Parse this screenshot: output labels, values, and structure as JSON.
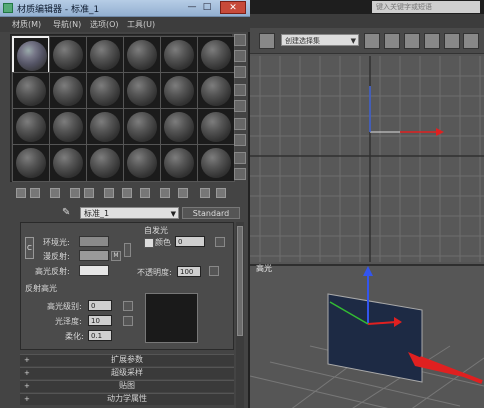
{
  "max_window": {
    "search_placeholder": "键入关键字或短语",
    "selection_set": "创建选择集",
    "viewport_label": "高光",
    "toolbar_icons": [
      "link-icon",
      "unlink-icon",
      "mirror-icon",
      "align-icon",
      "layer-icon",
      "render-setup-icon",
      "render-frame-icon",
      "render-icon"
    ],
    "viewport_bg": "#585858",
    "grid_color": "#6e6e6e",
    "arrow_color": "#e02020"
  },
  "editor": {
    "title": "材质编辑器 - 标准_1",
    "minimize_label": "—",
    "maximize_label": "□",
    "close_label": "✕",
    "menus": [
      "材质(M)",
      "导航(N)",
      "选项(O)",
      "工具(U)"
    ],
    "slot_count": 24,
    "active_slot": 0,
    "material_name": "标准_1",
    "material_type": "Standard",
    "sample_type_icons": [
      "sphere-icon",
      "backlight-icon",
      "background-icon",
      "uv-tiling-icon",
      "video-check-icon",
      "preview-icon",
      "options-icon",
      "select-by-material-icon",
      "navigator-icon"
    ],
    "toolbar_icons": [
      "get-material-icon",
      "put-to-scene-icon",
      "assign-material-icon",
      "reset-icon",
      "copy-material-icon",
      "make-unique-icon",
      "put-to-library-icon",
      "material-id-icon",
      "show-map-icon",
      "show-end-icon",
      "go-parent-icon",
      "go-sibling-icon"
    ]
  },
  "params": {
    "ambient_label": "环境光:",
    "diffuse_label": "漫反射:",
    "specular_label": "高光反射:",
    "self_illum_group": "自发光",
    "color_checkbox_label": "颜色",
    "self_illum_value": "0",
    "opacity_label": "不透明度:",
    "opacity_value": "100",
    "lock_label": "C",
    "map_letter": "M",
    "specular_group": "反射高光",
    "spec_level_label": "高光级别:",
    "spec_level_value": "0",
    "gloss_label": "光泽度:",
    "gloss_value": "10",
    "soften_label": "柔化:",
    "soften_value": "0.1",
    "ambient_color": "#8a8a8a",
    "diffuse_color": "#9a9a9a",
    "specular_color": "#e6e6e6"
  },
  "rollouts": [
    "扩展参数",
    "超级采样",
    "贴图",
    "动力学属性"
  ]
}
